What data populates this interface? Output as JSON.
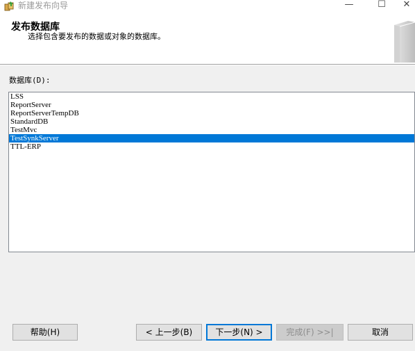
{
  "window": {
    "title": "新建发布向导",
    "minimize_glyph": "—",
    "maximize_glyph": "☐",
    "close_glyph": "✕"
  },
  "header": {
    "title": "发布数据库",
    "subtitle": "选择包含要发布的数据或对象的数据库。"
  },
  "database_list": {
    "label": "数据库(D):",
    "items": [
      {
        "name": "LSS",
        "selected": false
      },
      {
        "name": "ReportServer",
        "selected": false
      },
      {
        "name": "ReportServerTempDB",
        "selected": false
      },
      {
        "name": "StandardDB",
        "selected": false
      },
      {
        "name": "TestMvc",
        "selected": false
      },
      {
        "name": "TestSynkServer",
        "selected": true
      },
      {
        "name": "TTL-ERP",
        "selected": false
      }
    ]
  },
  "buttons": {
    "help": "帮助(H)",
    "back": "< 上一步(B)",
    "next": "下一步(N) >",
    "finish": "完成(F) >>|",
    "cancel": "取消"
  },
  "colors": {
    "selection": "#0078d7",
    "dialog_background": "#f0f0f0"
  }
}
